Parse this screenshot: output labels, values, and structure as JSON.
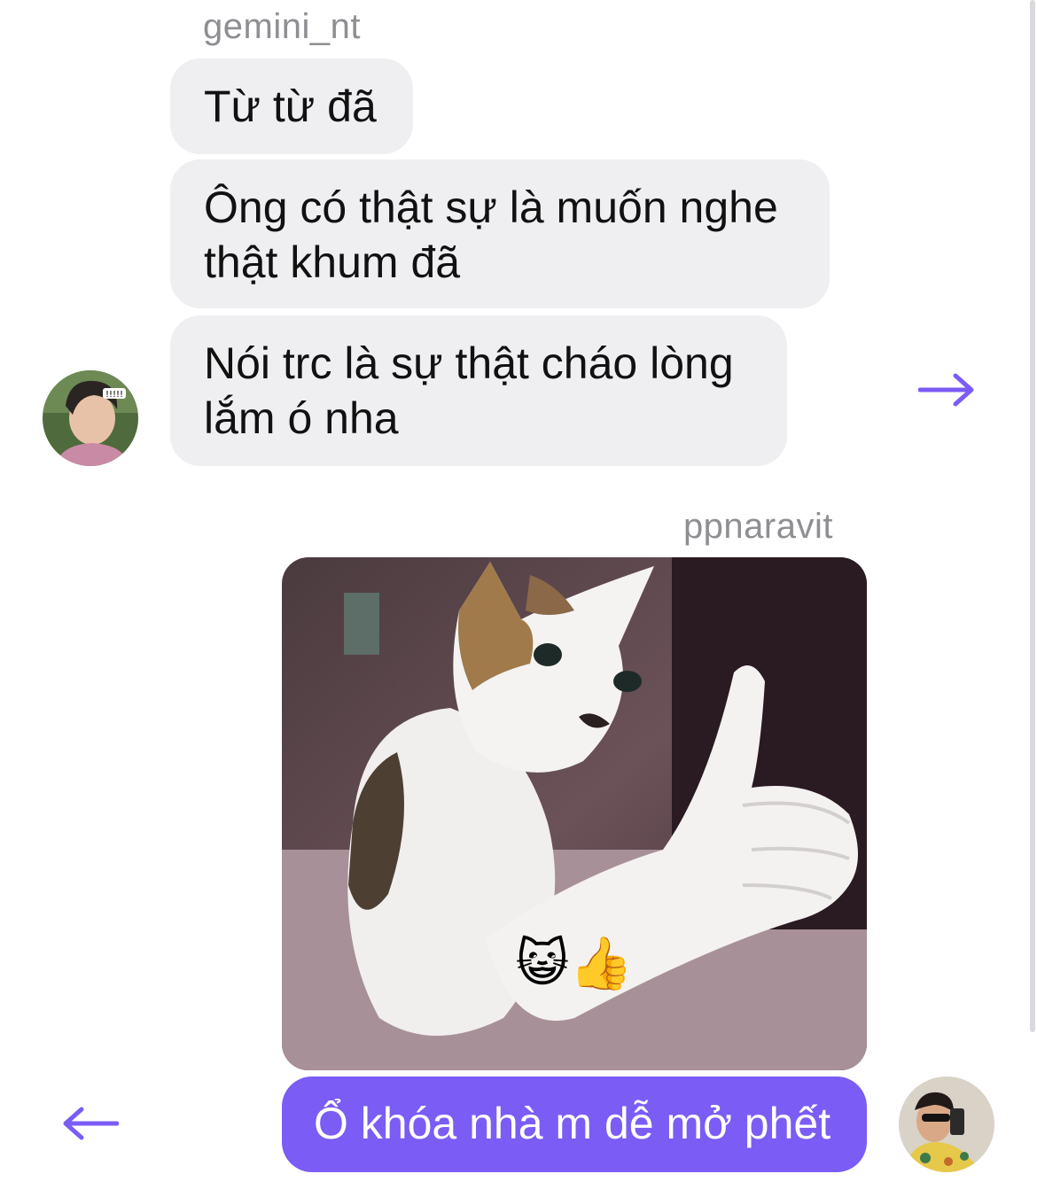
{
  "thread": {
    "incoming": {
      "sender": "gemini_nt",
      "messages": [
        "Từ từ đã",
        "Ông có thật sự là muốn nghe thật khum đã",
        "Nói trc là sự thật cháo lòng lắm ó nha"
      ],
      "avatar_badge": "!!!!!"
    },
    "outgoing": {
      "sender": "ppnaravit",
      "photo_emoji": "😺👍",
      "message": "Ổ khóa nhà m dễ mở phết"
    }
  },
  "colors": {
    "accent": "#7b5cf5",
    "incoming_bubble": "#efeff2",
    "sender_gray": "#8e8e93"
  },
  "icons": {
    "forward_arrow": "arrow-right-icon",
    "back_arrow": "arrow-left-icon"
  }
}
